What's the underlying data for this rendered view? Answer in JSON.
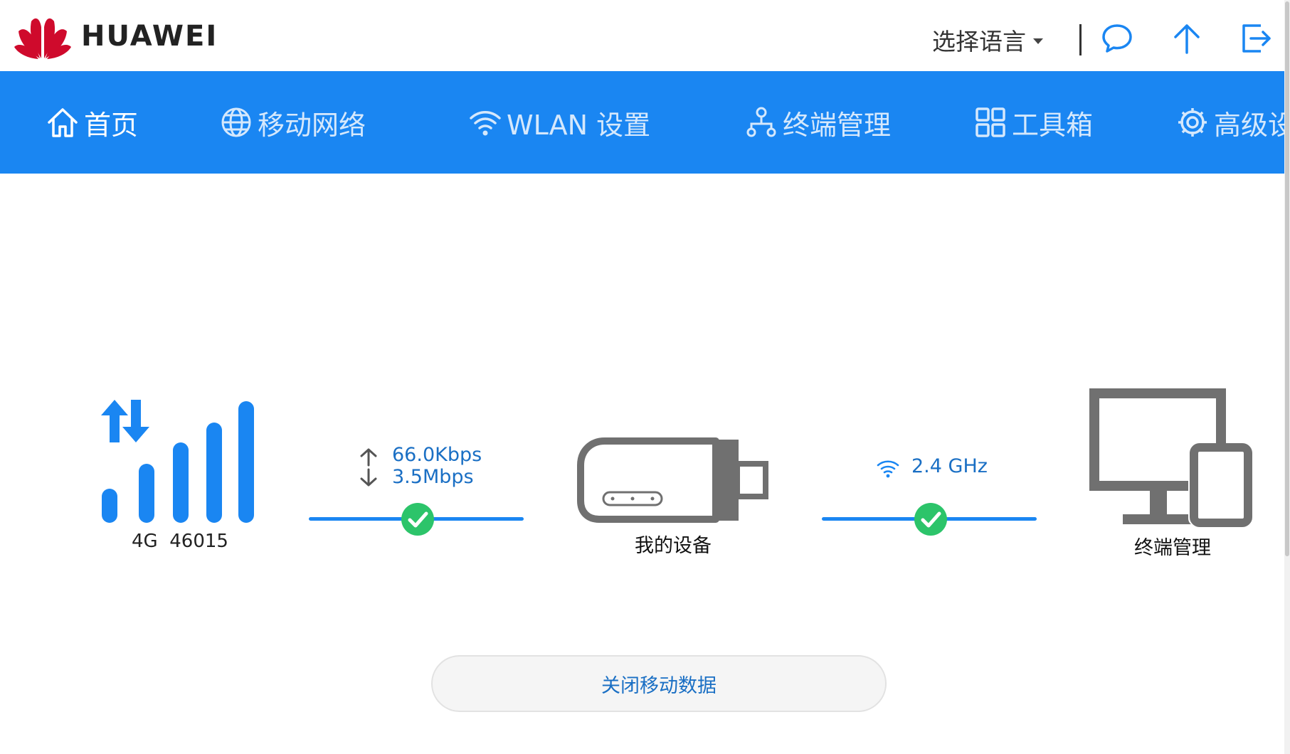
{
  "header": {
    "brand": "HUAWEI",
    "language_selector": "选择语言"
  },
  "nav": {
    "items": [
      {
        "label": "首页",
        "icon": "home-icon",
        "active": true
      },
      {
        "label": "移动网络",
        "icon": "globe-icon"
      },
      {
        "label": "WLAN 设置",
        "icon": "wifi-icon"
      },
      {
        "label": "终端管理",
        "icon": "device-tree-icon"
      },
      {
        "label": "工具箱",
        "icon": "grid-icon"
      },
      {
        "label": "高级设",
        "icon": "gear-icon"
      }
    ]
  },
  "status": {
    "network_type": "4G",
    "operator": "46015",
    "upload_speed": "66.0Kbps",
    "download_speed": "3.5Mbps",
    "device_label": "我的设备",
    "wifi_band": "2.4 GHz",
    "terminal_label": "终端管理"
  },
  "actions": {
    "mobile_data_button": "关闭移动数据"
  },
  "colors": {
    "nav_blue": "#1a86f2",
    "check_green": "#2cc46a",
    "link_blue": "#1a6fc4",
    "icon_gray": "#707070",
    "logo_red": "#cf0a2c"
  }
}
